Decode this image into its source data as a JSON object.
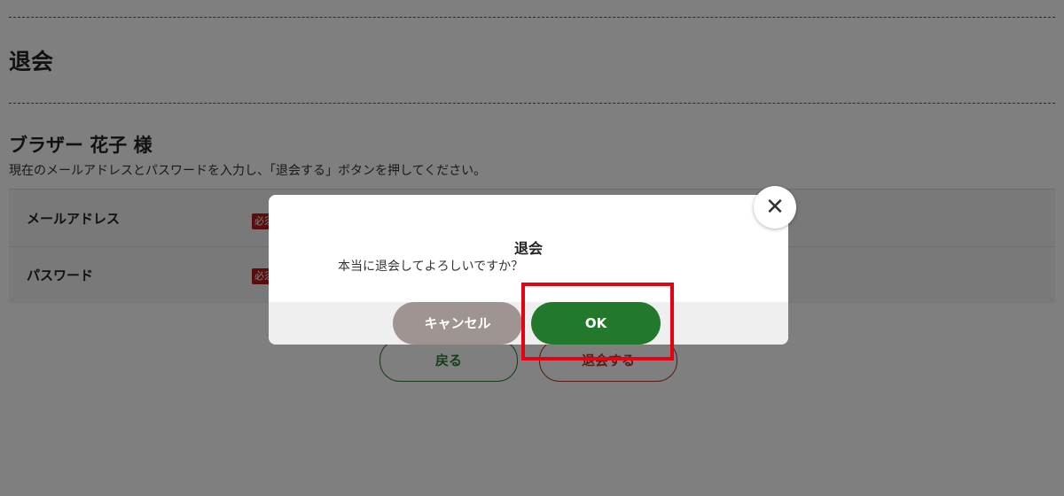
{
  "page": {
    "title": "退会",
    "user_name": "ブラザー 花子 様",
    "instruction": "現在のメールアドレスとパスワードを入力し、「退会する」ボタンを押してください。"
  },
  "form": {
    "rows": [
      {
        "label": "メールアドレス",
        "required_badge": "必須"
      },
      {
        "label": "パスワード",
        "required_badge": "必須"
      }
    ],
    "back_button": "戻る",
    "withdraw_button": "退会する"
  },
  "modal": {
    "title": "退会",
    "message": "本当に退会してよろしいですか？",
    "cancel_button": "キャンセル",
    "ok_button": "OK",
    "close_icon": "close-icon"
  },
  "colors": {
    "ok_green": "#22792c",
    "cancel_gray": "#9e9592",
    "required_red": "#b01d1d",
    "highlight_red": "#e60012"
  }
}
